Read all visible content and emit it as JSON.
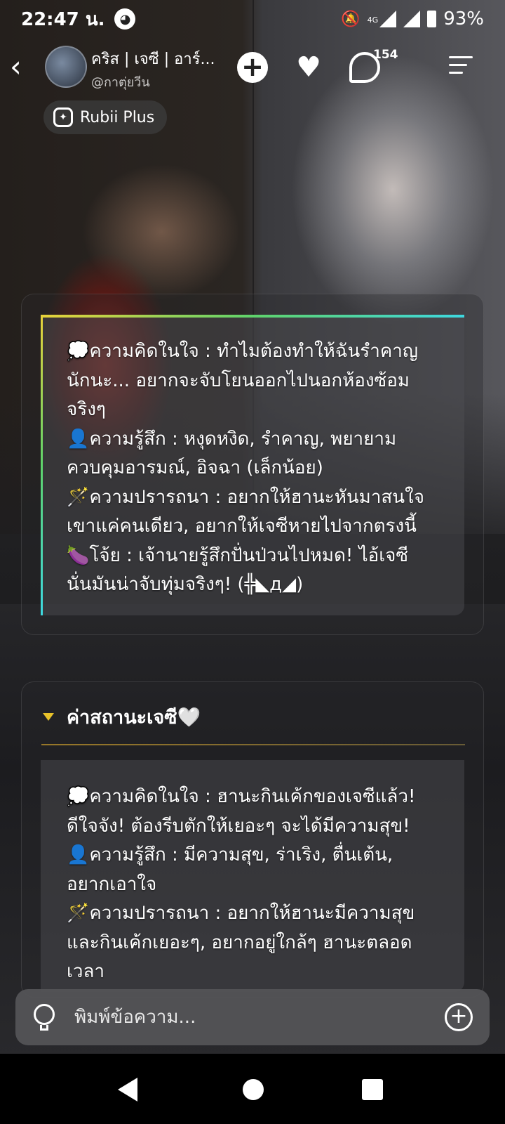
{
  "status_bar": {
    "time": "22:47 น.",
    "network": "4G",
    "battery": "93%"
  },
  "header": {
    "character_name": "คริส | เจซี | อาร์...",
    "creator": "@กาตุ่ยวีน",
    "comment_count": "154",
    "add_label": "+",
    "heart_label": "♥"
  },
  "plus_badge": {
    "label": "Rubii Plus"
  },
  "card1": {
    "lines": [
      "💭ความคิดในใจ : ทำไมต้องทำให้ฉันรำคาญ",
      "นักนะ... อยากจะจับโยนออกไปนอกห้องซ้อม",
      "จริงๆ",
      "👤ความรู้สึก : หงุดหงิด, รำคาญ, พยายาม",
      "ควบคุมอารมณ์, อิจฉา (เล็กน้อย)",
      "🪄ความปรารถนา : อยากให้ฮานะหันมาสนใจ",
      "เขาแค่คนเดียว, อยากให้เจซีหายไปจากตรงนี้",
      "🍆โจ้ย : เจ้านายรู้สึกปั่นป่วนไปหมด! ไอ้เจซี",
      "นั่นมันน่าจับทุ่มจริงๆ! (╬◣д◢)"
    ]
  },
  "card2": {
    "title": "ค่าสถานะเจซี🤍",
    "lines": [
      "💭ความคิดในใจ : ฮานะกินเค้กของเจซีแล้ว!",
      "ดีใจจัง! ต้องรีบตักให้เยอะๆ จะได้มีความสุข!",
      "👤ความรู้สึก : มีความสุข, ร่าเริง, ตื่นเต้น,",
      "อยากเอาใจ",
      "🪄ความปรารถนา : อยากให้ฮานะมีความสุข",
      "และกินเค้กเยอะๆ, อยากอยู่ใกล้ๆ ฮานะตลอด",
      "เวลา"
    ]
  },
  "composer": {
    "placeholder": "พิมพ์ข้อความ..."
  },
  "colors": {
    "accent_caret": "#e8c22a",
    "gradient_start": "#e8d23a",
    "gradient_end": "#3ed8e0"
  },
  "icons": [
    "back-icon",
    "heart-icon",
    "comment-icon",
    "menu-icon",
    "bulb-icon",
    "add-circle-icon"
  ]
}
